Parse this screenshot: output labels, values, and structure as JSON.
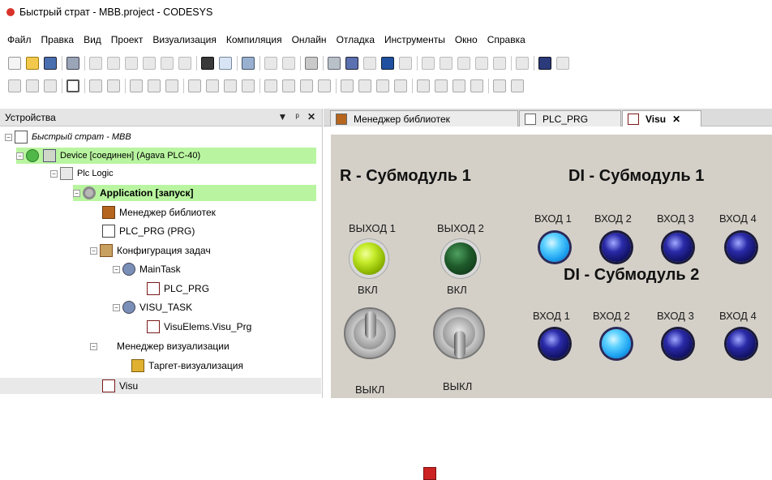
{
  "window": {
    "title": "Быстрый страт - MBB.project - CODESYS"
  },
  "menu": [
    "Файл",
    "Правка",
    "Вид",
    "Проект",
    "Визуализация",
    "Компиляция",
    "Онлайн",
    "Отладка",
    "Инструменты",
    "Окно",
    "Справка"
  ],
  "devices_panel": {
    "title": "Устройства",
    "controls": {
      "dropdown": "▼",
      "pin": "ᵖ",
      "close": "✕"
    },
    "tree": [
      {
        "label": "Быстрый страт - MBB",
        "italic": true
      },
      {
        "label": "Device [соединен] (Agava PLC-40)",
        "highlight": true
      },
      {
        "label": "Plc Logic"
      },
      {
        "label": "Application [запуск]",
        "highlight": true,
        "bold": true
      },
      {
        "label": "Менеджер библиотек"
      },
      {
        "label": "PLC_PRG (PRG)"
      },
      {
        "label": "Конфигурация задач"
      },
      {
        "label": "MainTask"
      },
      {
        "label": "PLC_PRG"
      },
      {
        "label": "VISU_TASK"
      },
      {
        "label": "VisuElems.Visu_Prg"
      },
      {
        "label": "Менеджер визуализации"
      },
      {
        "label": "Таргет-визуализация"
      },
      {
        "label": "Visu"
      }
    ]
  },
  "tabs": [
    {
      "label": "Менеджер библиотек",
      "active": false
    },
    {
      "label": "PLC_PRG",
      "active": false
    },
    {
      "label": "Visu",
      "active": true,
      "close": "✕"
    }
  ],
  "visu": {
    "r_header": "R - Субмодуль 1",
    "di1_header": "DI - Субмодуль 1",
    "di2_header": "DI - Субмодуль 2",
    "outputs": [
      {
        "label": "ВЫХОД 1",
        "on": true
      },
      {
        "label": "ВЫХОД 2",
        "on": false
      }
    ],
    "switch_on": "ВКЛ",
    "switch_off": "ВЫКЛ",
    "di1": [
      {
        "label": "ВХОД 1",
        "on": true
      },
      {
        "label": "ВХОД 2",
        "on": false
      },
      {
        "label": "ВХОД 3",
        "on": false
      },
      {
        "label": "ВХОД 4",
        "on": false
      }
    ],
    "di2": [
      {
        "label": "ВХОД 1",
        "on": false
      },
      {
        "label": "ВХОД 2",
        "on": true
      },
      {
        "label": "ВХОД 3",
        "on": false
      },
      {
        "label": "ВХОД 4",
        "on": false
      }
    ]
  }
}
